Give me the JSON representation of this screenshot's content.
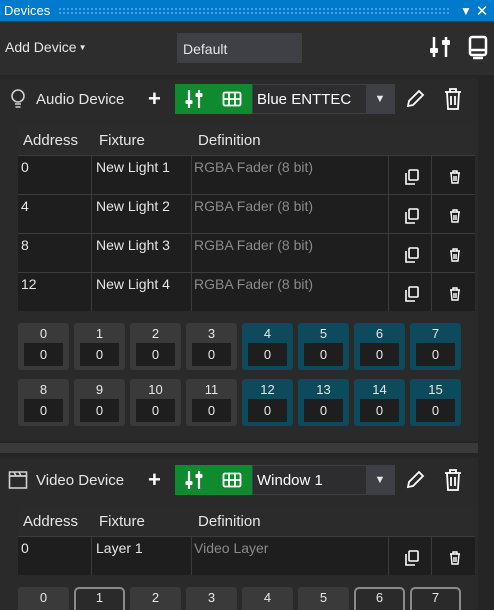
{
  "window": {
    "title": "Devices",
    "menu_glyph": "▼",
    "close_glyph": "✕"
  },
  "toolbar": {
    "add_device_label": "Add Device",
    "add_device_caret": "▼",
    "project_name": "Default",
    "icons": [
      "mixer-icon",
      "layout-panel-icon"
    ]
  },
  "colors": {
    "accent": "#007acc",
    "green": "#0f8a2e",
    "teal": "#0c4a5c"
  },
  "devices": [
    {
      "name": "Audio Device",
      "icon": "lightbulb-icon",
      "plus": "+",
      "selected_output": "Blue ENTTEC",
      "dropdown_arrow": "▼",
      "columns": [
        "Address",
        "Fixture",
        "Definition"
      ],
      "rows": [
        {
          "address": "0",
          "fixture": "New Light 1",
          "definition": "RGBA Fader (8 bit)"
        },
        {
          "address": "4",
          "fixture": "New Light 2",
          "definition": "RGBA Fader (8 bit)"
        },
        {
          "address": "8",
          "fixture": "New Light 3",
          "definition": "RGBA Fader (8 bit)"
        },
        {
          "address": "12",
          "fixture": "New Light 4",
          "definition": "RGBA Fader (8 bit)"
        }
      ],
      "channels": [
        {
          "ch": "0",
          "val": "0"
        },
        {
          "ch": "1",
          "val": "0"
        },
        {
          "ch": "2",
          "val": "0"
        },
        {
          "ch": "3",
          "val": "0"
        },
        {
          "ch": "4",
          "val": "0"
        },
        {
          "ch": "5",
          "val": "0"
        },
        {
          "ch": "6",
          "val": "0"
        },
        {
          "ch": "7",
          "val": "0"
        },
        {
          "ch": "8",
          "val": "0"
        },
        {
          "ch": "9",
          "val": "0"
        },
        {
          "ch": "10",
          "val": "0"
        },
        {
          "ch": "11",
          "val": "0"
        },
        {
          "ch": "12",
          "val": "0"
        },
        {
          "ch": "13",
          "val": "0"
        },
        {
          "ch": "14",
          "val": "0"
        },
        {
          "ch": "15",
          "val": "0"
        }
      ]
    },
    {
      "name": "Video Device",
      "icon": "clapperboard-icon",
      "plus": "+",
      "selected_output": "Window 1",
      "dropdown_arrow": "▼",
      "columns": [
        "Address",
        "Fixture",
        "Definition"
      ],
      "rows": [
        {
          "address": "0",
          "fixture": "Layer 1",
          "definition": "Video Layer"
        }
      ],
      "channels": [
        {
          "ch": "0"
        },
        {
          "ch": "1"
        },
        {
          "ch": "2"
        },
        {
          "ch": "3"
        },
        {
          "ch": "4"
        },
        {
          "ch": "5"
        },
        {
          "ch": "6"
        },
        {
          "ch": "7"
        }
      ]
    }
  ]
}
